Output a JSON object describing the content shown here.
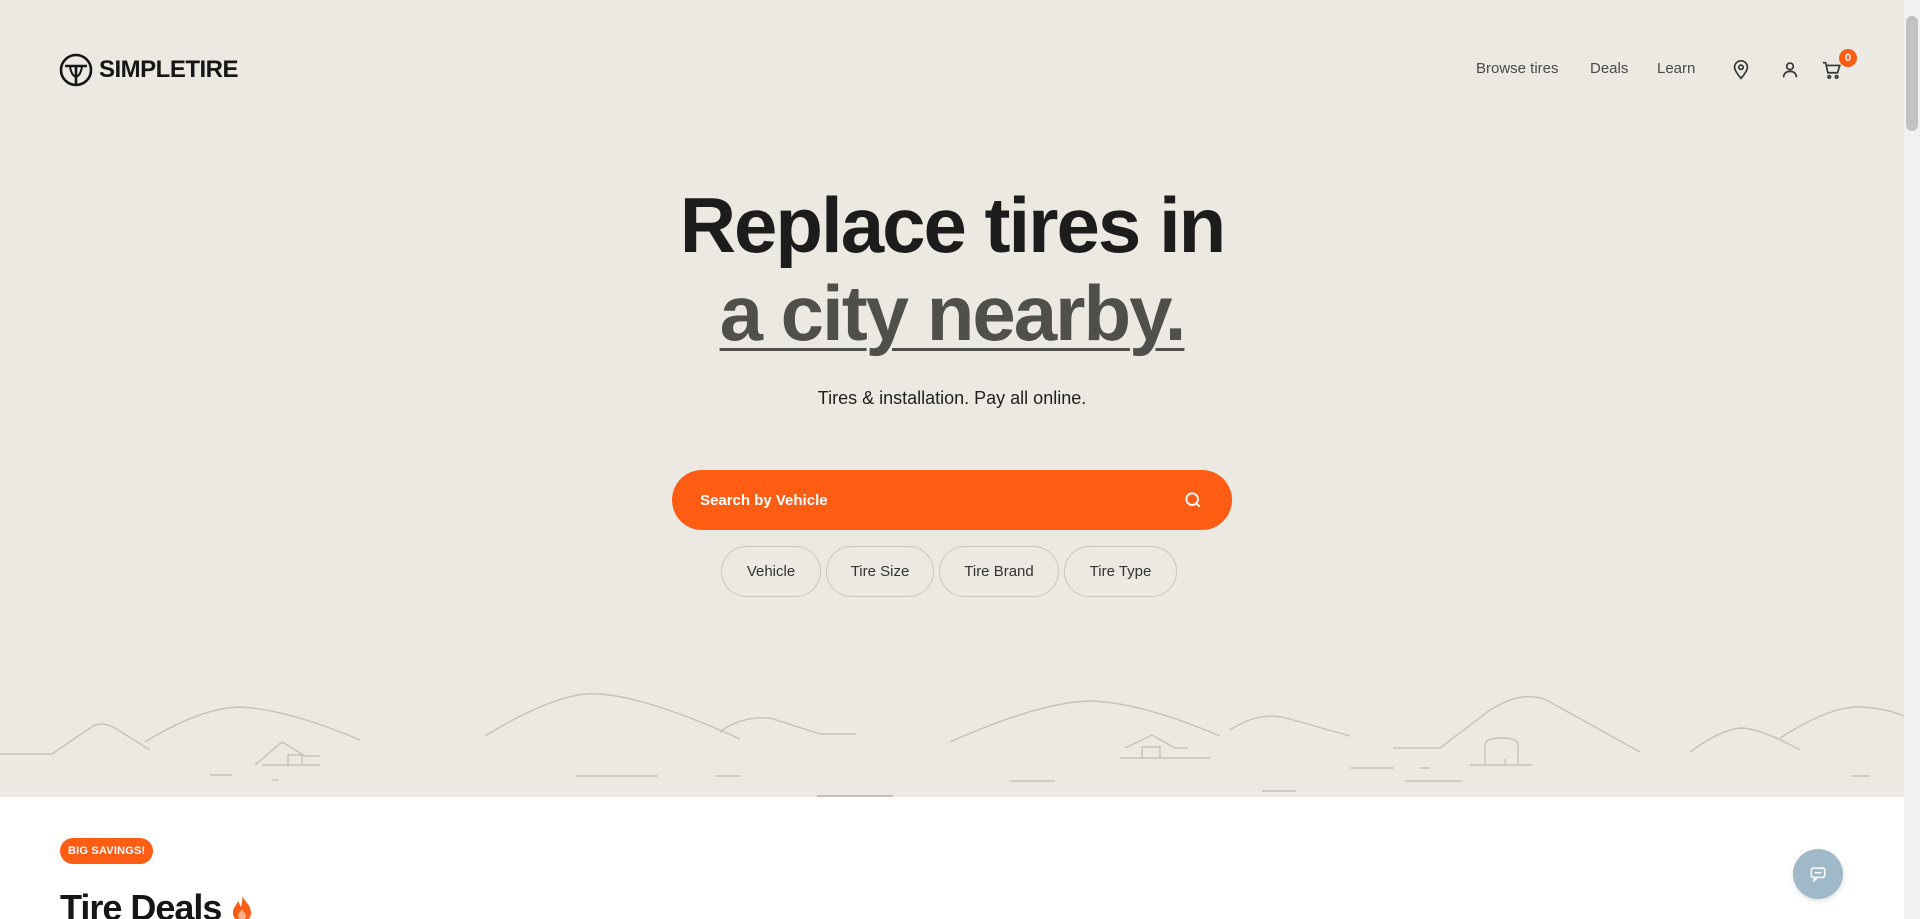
{
  "brand": {
    "name": "SIMPLETIRE",
    "accent": "#ff5c14",
    "hero_bg": "#ebe9e2"
  },
  "nav": {
    "links": [
      {
        "label": "Browse tires"
      },
      {
        "label": "Deals"
      },
      {
        "label": "Learn"
      }
    ],
    "icons": [
      "location-pin-icon",
      "user-icon",
      "cart-icon"
    ],
    "cart_count": "0"
  },
  "hero": {
    "line1": "Replace tires in",
    "line2": "a city nearby.",
    "subtitle": "Tires & installation. Pay all online.",
    "search_label": "Search by Vehicle",
    "chips": [
      {
        "label": "Vehicle"
      },
      {
        "label": "Tire Size"
      },
      {
        "label": "Tire Brand"
      },
      {
        "label": "Tire Type"
      }
    ]
  },
  "deals": {
    "badge": "BIG SAVINGS!",
    "title": "Tire Deals"
  }
}
